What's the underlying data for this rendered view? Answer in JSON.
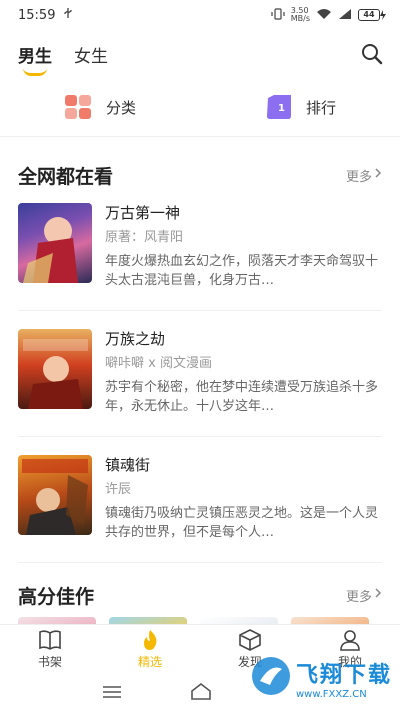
{
  "status_bar": {
    "time": "15:59",
    "usb_icon": "usb-icon",
    "net_speed": "3.50\nMB/s",
    "battery": "44"
  },
  "header": {
    "tabs": [
      {
        "label": "男生",
        "active": true
      },
      {
        "label": "女生",
        "active": false
      }
    ],
    "accent": "#f5b800"
  },
  "quick_links": [
    {
      "label": "分类",
      "icon": "category-grid-icon"
    },
    {
      "label": "排行",
      "icon": "ranking-icon"
    }
  ],
  "section_trending": {
    "title": "全网都在看",
    "more": "更多",
    "books": [
      {
        "title": "万古第一神",
        "author": "原著：风青阳",
        "desc": "年度火爆热血玄幻之作，陨落天才李天命驾驭十头太古混沌巨兽，化身万古…"
      },
      {
        "title": "万族之劫",
        "author": "噼咔噼 x 阅文漫画",
        "desc": "苏宇有个秘密，他在梦中连续遭受万族追杀十多年，永无休止。十八岁这年…"
      },
      {
        "title": "镇魂街",
        "author": "许辰",
        "desc": "镇魂街乃吸纳亡灵镇压恶灵之地。这是一个人灵共存的世界，但不是每个人…"
      }
    ]
  },
  "section_top": {
    "title": "高分佳作",
    "more": "更多"
  },
  "bottom_nav": [
    {
      "label": "书架",
      "icon": "book-icon",
      "active": false
    },
    {
      "label": "精选",
      "icon": "flame-icon",
      "active": true
    },
    {
      "label": "发现",
      "icon": "cube-icon",
      "active": false
    },
    {
      "label": "我的",
      "icon": "user-icon",
      "active": false
    }
  ],
  "watermark": {
    "text": "飞翔下载",
    "url_text": "www.FXXZ.CN"
  }
}
